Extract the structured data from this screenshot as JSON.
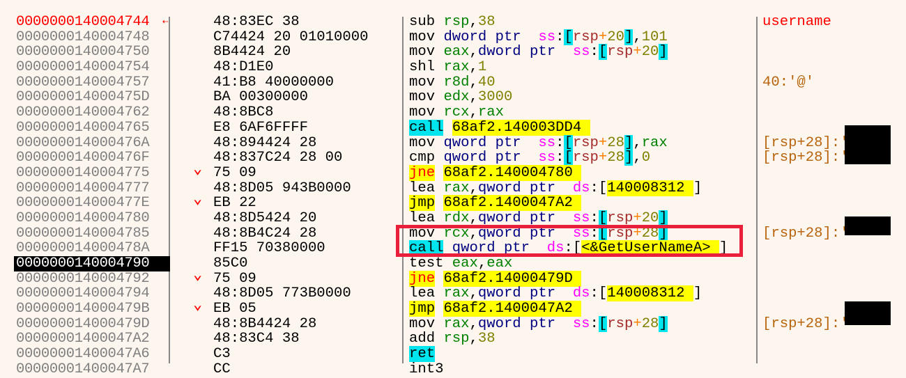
{
  "view": "disassembly",
  "rows": [
    {
      "address": "0000000140004744",
      "bytes": "48:83EC 38",
      "jump": "",
      "comment": "username",
      "comment_style": "label",
      "disasm": [
        {
          "t": "sub",
          "c": "plain"
        },
        {
          "t": " "
        },
        {
          "t": "rsp",
          "c": "reg"
        },
        {
          "t": ","
        },
        {
          "t": "38",
          "c": "num"
        }
      ]
    },
    {
      "address": "0000000140004748",
      "bytes": "C74424 20 01010000",
      "jump": "",
      "comment": "",
      "disasm": [
        {
          "t": "mov",
          "c": "plain"
        },
        {
          "t": " "
        },
        {
          "t": "dword ptr",
          "c": "size"
        },
        {
          "t": "  "
        },
        {
          "t": "ss",
          "c": "seg"
        },
        {
          "t": ":"
        },
        {
          "t": "[",
          "c": "brk"
        },
        {
          "t": "rsp",
          "c": "memreg"
        },
        {
          "t": "+",
          "c": "plus"
        },
        {
          "t": "20",
          "c": "num"
        },
        {
          "t": "]",
          "c": "brk"
        },
        {
          "t": ","
        },
        {
          "t": "101",
          "c": "num"
        }
      ]
    },
    {
      "address": "0000000140004750",
      "bytes": "8B4424 20",
      "jump": "",
      "comment": "",
      "disasm": [
        {
          "t": "mov",
          "c": "plain"
        },
        {
          "t": " "
        },
        {
          "t": "eax",
          "c": "reg"
        },
        {
          "t": ","
        },
        {
          "t": "dword ptr",
          "c": "size"
        },
        {
          "t": "  "
        },
        {
          "t": "ss",
          "c": "seg"
        },
        {
          "t": ":"
        },
        {
          "t": "[",
          "c": "brk"
        },
        {
          "t": "rsp",
          "c": "memreg"
        },
        {
          "t": "+",
          "c": "plus"
        },
        {
          "t": "20",
          "c": "num"
        },
        {
          "t": "]",
          "c": "brk"
        }
      ]
    },
    {
      "address": "0000000140004754",
      "bytes": "48:D1E0",
      "jump": "",
      "comment": "",
      "disasm": [
        {
          "t": "shl",
          "c": "plain"
        },
        {
          "t": " "
        },
        {
          "t": "rax",
          "c": "reg"
        },
        {
          "t": ","
        },
        {
          "t": "1",
          "c": "num"
        }
      ]
    },
    {
      "address": "0000000140004757",
      "bytes": "41:B8 40000000",
      "jump": "",
      "comment": "40:'@'",
      "disasm": [
        {
          "t": "mov",
          "c": "plain"
        },
        {
          "t": " "
        },
        {
          "t": "r8d",
          "c": "reg"
        },
        {
          "t": ","
        },
        {
          "t": "40",
          "c": "num"
        }
      ]
    },
    {
      "address": "000000014000475D",
      "bytes": "BA 00300000",
      "jump": "",
      "comment": "",
      "disasm": [
        {
          "t": "mov",
          "c": "plain"
        },
        {
          "t": " "
        },
        {
          "t": "edx",
          "c": "reg"
        },
        {
          "t": ","
        },
        {
          "t": "3000",
          "c": "num"
        }
      ]
    },
    {
      "address": "0000000140004762",
      "bytes": "48:8BC8",
      "jump": "",
      "comment": "",
      "disasm": [
        {
          "t": "mov",
          "c": "plain"
        },
        {
          "t": " "
        },
        {
          "t": "rcx",
          "c": "reg"
        },
        {
          "t": ","
        },
        {
          "t": "rax",
          "c": "reg"
        }
      ]
    },
    {
      "address": "0000000140004765",
      "bytes": "E8 6AF6FFFF",
      "jump": "",
      "comment": "",
      "disasm": [
        {
          "t": "call",
          "c": "kw-call"
        },
        {
          "t": " "
        },
        {
          "t": "68af2.140003DD4 ",
          "c": "target"
        }
      ]
    },
    {
      "address": "000000014000476A",
      "bytes": "48:894424 28",
      "jump": "",
      "comment": "[rsp+28]:'",
      "redacted": true,
      "disasm": [
        {
          "t": "mov",
          "c": "plain"
        },
        {
          "t": " "
        },
        {
          "t": "qword ptr",
          "c": "size"
        },
        {
          "t": "  "
        },
        {
          "t": "ss",
          "c": "seg"
        },
        {
          "t": ":"
        },
        {
          "t": "[",
          "c": "brk"
        },
        {
          "t": "rsp",
          "c": "memreg"
        },
        {
          "t": "+",
          "c": "plus"
        },
        {
          "t": "28",
          "c": "num"
        },
        {
          "t": "]",
          "c": "brk"
        },
        {
          "t": ","
        },
        {
          "t": "rax",
          "c": "reg"
        }
      ]
    },
    {
      "address": "000000014000476F",
      "bytes": "48:837C24 28 00",
      "jump": "",
      "comment": "[rsp+28]:'",
      "redacted": true,
      "disasm": [
        {
          "t": "cmp",
          "c": "plain"
        },
        {
          "t": " "
        },
        {
          "t": "qword ptr",
          "c": "size"
        },
        {
          "t": "  "
        },
        {
          "t": "ss",
          "c": "seg"
        },
        {
          "t": ":"
        },
        {
          "t": "[",
          "c": "brk"
        },
        {
          "t": "rsp",
          "c": "memreg"
        },
        {
          "t": "+",
          "c": "plus"
        },
        {
          "t": "28",
          "c": "num"
        },
        {
          "t": "]",
          "c": "brk"
        },
        {
          "t": ","
        },
        {
          "t": "0",
          "c": "num"
        }
      ]
    },
    {
      "address": "0000000140004775",
      "bytes": "75 09",
      "jump": "down",
      "comment": "",
      "disasm": [
        {
          "t": "jne",
          "c": "kw-jne"
        },
        {
          "t": " "
        },
        {
          "t": "68af2.140004780 ",
          "c": "target"
        }
      ]
    },
    {
      "address": "0000000140004777",
      "bytes": "48:8D05 943B0000",
      "jump": "",
      "comment": "",
      "disasm": [
        {
          "t": "lea",
          "c": "plain"
        },
        {
          "t": " "
        },
        {
          "t": "rax",
          "c": "reg"
        },
        {
          "t": ","
        },
        {
          "t": "qword ptr",
          "c": "size"
        },
        {
          "t": "  "
        },
        {
          "t": "ds",
          "c": "seg"
        },
        {
          "t": ":"
        },
        {
          "t": "[",
          "c": "plain"
        },
        {
          "t": "140008312 ",
          "c": "target"
        },
        {
          "t": "]",
          "c": "plain"
        }
      ]
    },
    {
      "address": "000000014000477E",
      "bytes": "EB 22",
      "jump": "down",
      "comment": "",
      "disasm": [
        {
          "t": "jmp",
          "c": "kw-jmp"
        },
        {
          "t": " "
        },
        {
          "t": "68af2.1400047A2 ",
          "c": "target"
        }
      ]
    },
    {
      "address": "0000000140004780",
      "bytes": "48:8D5424 20",
      "jump": "",
      "comment": "",
      "disasm": [
        {
          "t": "lea",
          "c": "plain"
        },
        {
          "t": " "
        },
        {
          "t": "rdx",
          "c": "reg"
        },
        {
          "t": ","
        },
        {
          "t": "qword ptr",
          "c": "size"
        },
        {
          "t": "  "
        },
        {
          "t": "ss",
          "c": "seg"
        },
        {
          "t": ":"
        },
        {
          "t": "[",
          "c": "brk"
        },
        {
          "t": "rsp",
          "c": "memreg"
        },
        {
          "t": "+",
          "c": "plus"
        },
        {
          "t": "20",
          "c": "num"
        },
        {
          "t": "]",
          "c": "brk"
        }
      ]
    },
    {
      "address": "0000000140004785",
      "bytes": "48:8B4C24 28",
      "jump": "",
      "comment": "[rsp+28]:'",
      "redacted": true,
      "disasm": [
        {
          "t": "mov",
          "c": "plain"
        },
        {
          "t": " "
        },
        {
          "t": "rcx",
          "c": "reg"
        },
        {
          "t": ","
        },
        {
          "t": "qword ptr",
          "c": "size"
        },
        {
          "t": "  "
        },
        {
          "t": "ss",
          "c": "seg"
        },
        {
          "t": ":"
        },
        {
          "t": "[",
          "c": "brk"
        },
        {
          "t": "rsp",
          "c": "memreg"
        },
        {
          "t": "+",
          "c": "plus"
        },
        {
          "t": "28",
          "c": "num"
        },
        {
          "t": "]",
          "c": "brk"
        }
      ]
    },
    {
      "address": "000000014000478A",
      "bytes": "FF15 70380000",
      "jump": "",
      "comment": "",
      "highlighted": true,
      "disasm": [
        {
          "t": "call",
          "c": "kw-call"
        },
        {
          "t": " "
        },
        {
          "t": "qword ptr",
          "c": "size"
        },
        {
          "t": "  "
        },
        {
          "t": "ds",
          "c": "seg"
        },
        {
          "t": ":"
        },
        {
          "t": "[",
          "c": "plain"
        },
        {
          "t": "<&GetUserNameA> ",
          "c": "target"
        },
        {
          "t": "]",
          "c": "plain"
        }
      ]
    },
    {
      "address": "0000000140004790",
      "bytes": "85C0",
      "jump": "",
      "comment": "",
      "selected": true,
      "disasm": [
        {
          "t": "test",
          "c": "plain"
        },
        {
          "t": " "
        },
        {
          "t": "eax",
          "c": "reg"
        },
        {
          "t": ","
        },
        {
          "t": "eax",
          "c": "reg"
        }
      ]
    },
    {
      "address": "0000000140004792",
      "bytes": "75 09",
      "jump": "down",
      "comment": "",
      "disasm": [
        {
          "t": "jne",
          "c": "kw-jne"
        },
        {
          "t": " "
        },
        {
          "t": "68af2.14000479D ",
          "c": "target"
        }
      ]
    },
    {
      "address": "0000000140004794",
      "bytes": "48:8D05 773B0000",
      "jump": "",
      "comment": "",
      "disasm": [
        {
          "t": "lea",
          "c": "plain"
        },
        {
          "t": " "
        },
        {
          "t": "rax",
          "c": "reg"
        },
        {
          "t": ","
        },
        {
          "t": "qword ptr",
          "c": "size"
        },
        {
          "t": "  "
        },
        {
          "t": "ds",
          "c": "seg"
        },
        {
          "t": ":"
        },
        {
          "t": "[",
          "c": "plain"
        },
        {
          "t": "140008312 ",
          "c": "target"
        },
        {
          "t": "]",
          "c": "plain"
        }
      ]
    },
    {
      "address": "000000014000479B",
      "bytes": "EB 05",
      "jump": "down",
      "comment": "",
      "disasm": [
        {
          "t": "jmp",
          "c": "kw-jmp"
        },
        {
          "t": " "
        },
        {
          "t": "68af2.1400047A2 ",
          "c": "target"
        }
      ]
    },
    {
      "address": "000000014000479D",
      "bytes": "48:8B4424 28",
      "jump": "",
      "comment": "[rsp+28]:'",
      "redacted": true,
      "disasm": [
        {
          "t": "mov",
          "c": "plain"
        },
        {
          "t": " "
        },
        {
          "t": "rax",
          "c": "reg"
        },
        {
          "t": ","
        },
        {
          "t": "qword ptr",
          "c": "size"
        },
        {
          "t": "  "
        },
        {
          "t": "ss",
          "c": "seg"
        },
        {
          "t": ":"
        },
        {
          "t": "[",
          "c": "brk"
        },
        {
          "t": "rsp",
          "c": "memreg"
        },
        {
          "t": "+",
          "c": "plus"
        },
        {
          "t": "28",
          "c": "num"
        },
        {
          "t": "]",
          "c": "brk"
        }
      ]
    },
    {
      "address": "00000001400047A2",
      "bytes": "48:83C4 38",
      "jump": "",
      "comment": "",
      "disasm": [
        {
          "t": "add",
          "c": "plain"
        },
        {
          "t": " "
        },
        {
          "t": "rsp",
          "c": "reg"
        },
        {
          "t": ","
        },
        {
          "t": "38",
          "c": "num"
        }
      ]
    },
    {
      "address": "00000001400047A6",
      "bytes": "C3",
      "jump": "",
      "comment": "",
      "disasm": [
        {
          "t": "ret",
          "c": "kw-ret"
        }
      ]
    },
    {
      "address": "00000001400047A7",
      "bytes": "CC",
      "jump": "",
      "comment": "",
      "disasm": [
        {
          "t": "int3",
          "c": "plain"
        }
      ]
    }
  ],
  "current_address": "0000000140004744",
  "selected_address": "0000000140004790",
  "highlighted_call": "call qword ptr ds:[<&GetUserNameA> ]",
  "colors": {
    "background": "#fdf6ef",
    "annotation_box": "#ea1f3c",
    "selection": "#000000",
    "current_ip": "#ff0000"
  }
}
